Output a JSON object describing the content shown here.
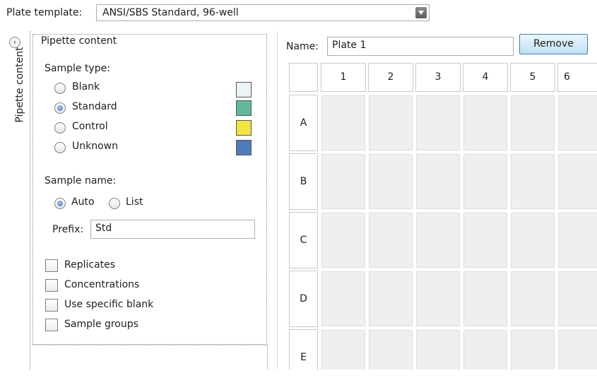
{
  "plate_template": {
    "label": "Plate template:",
    "value": "ANSI/SBS Standard, 96-well"
  },
  "side_tab": {
    "label": "Pipette content",
    "collapse_glyph": "‹"
  },
  "pipette": {
    "title": "Pipette content",
    "sample_type": {
      "label": "Sample type:",
      "options": [
        {
          "label": "Blank",
          "checked": false,
          "color": "#eaf4f6"
        },
        {
          "label": "Standard",
          "checked": true,
          "color": "#5fb89a"
        },
        {
          "label": "Control",
          "checked": false,
          "color": "#f0e63c"
        },
        {
          "label": "Unknown",
          "checked": false,
          "color": "#4f7bbd"
        }
      ]
    },
    "sample_name": {
      "label": "Sample name:",
      "auto_label": "Auto",
      "list_label": "List",
      "selected": "Auto",
      "prefix_label": "Prefix:",
      "prefix_value": "Std"
    },
    "options": [
      {
        "label": "Replicates",
        "checked": false
      },
      {
        "label": "Concentrations",
        "checked": false
      },
      {
        "label": "Use specific blank",
        "checked": false
      },
      {
        "label": "Sample groups",
        "checked": false
      }
    ]
  },
  "plate": {
    "name_label": "Name:",
    "name_value": "Plate 1",
    "remove_label": "Remove",
    "columns": [
      "1",
      "2",
      "3",
      "4",
      "5",
      "6"
    ],
    "rows": [
      "A",
      "B",
      "C",
      "D",
      "E"
    ]
  }
}
